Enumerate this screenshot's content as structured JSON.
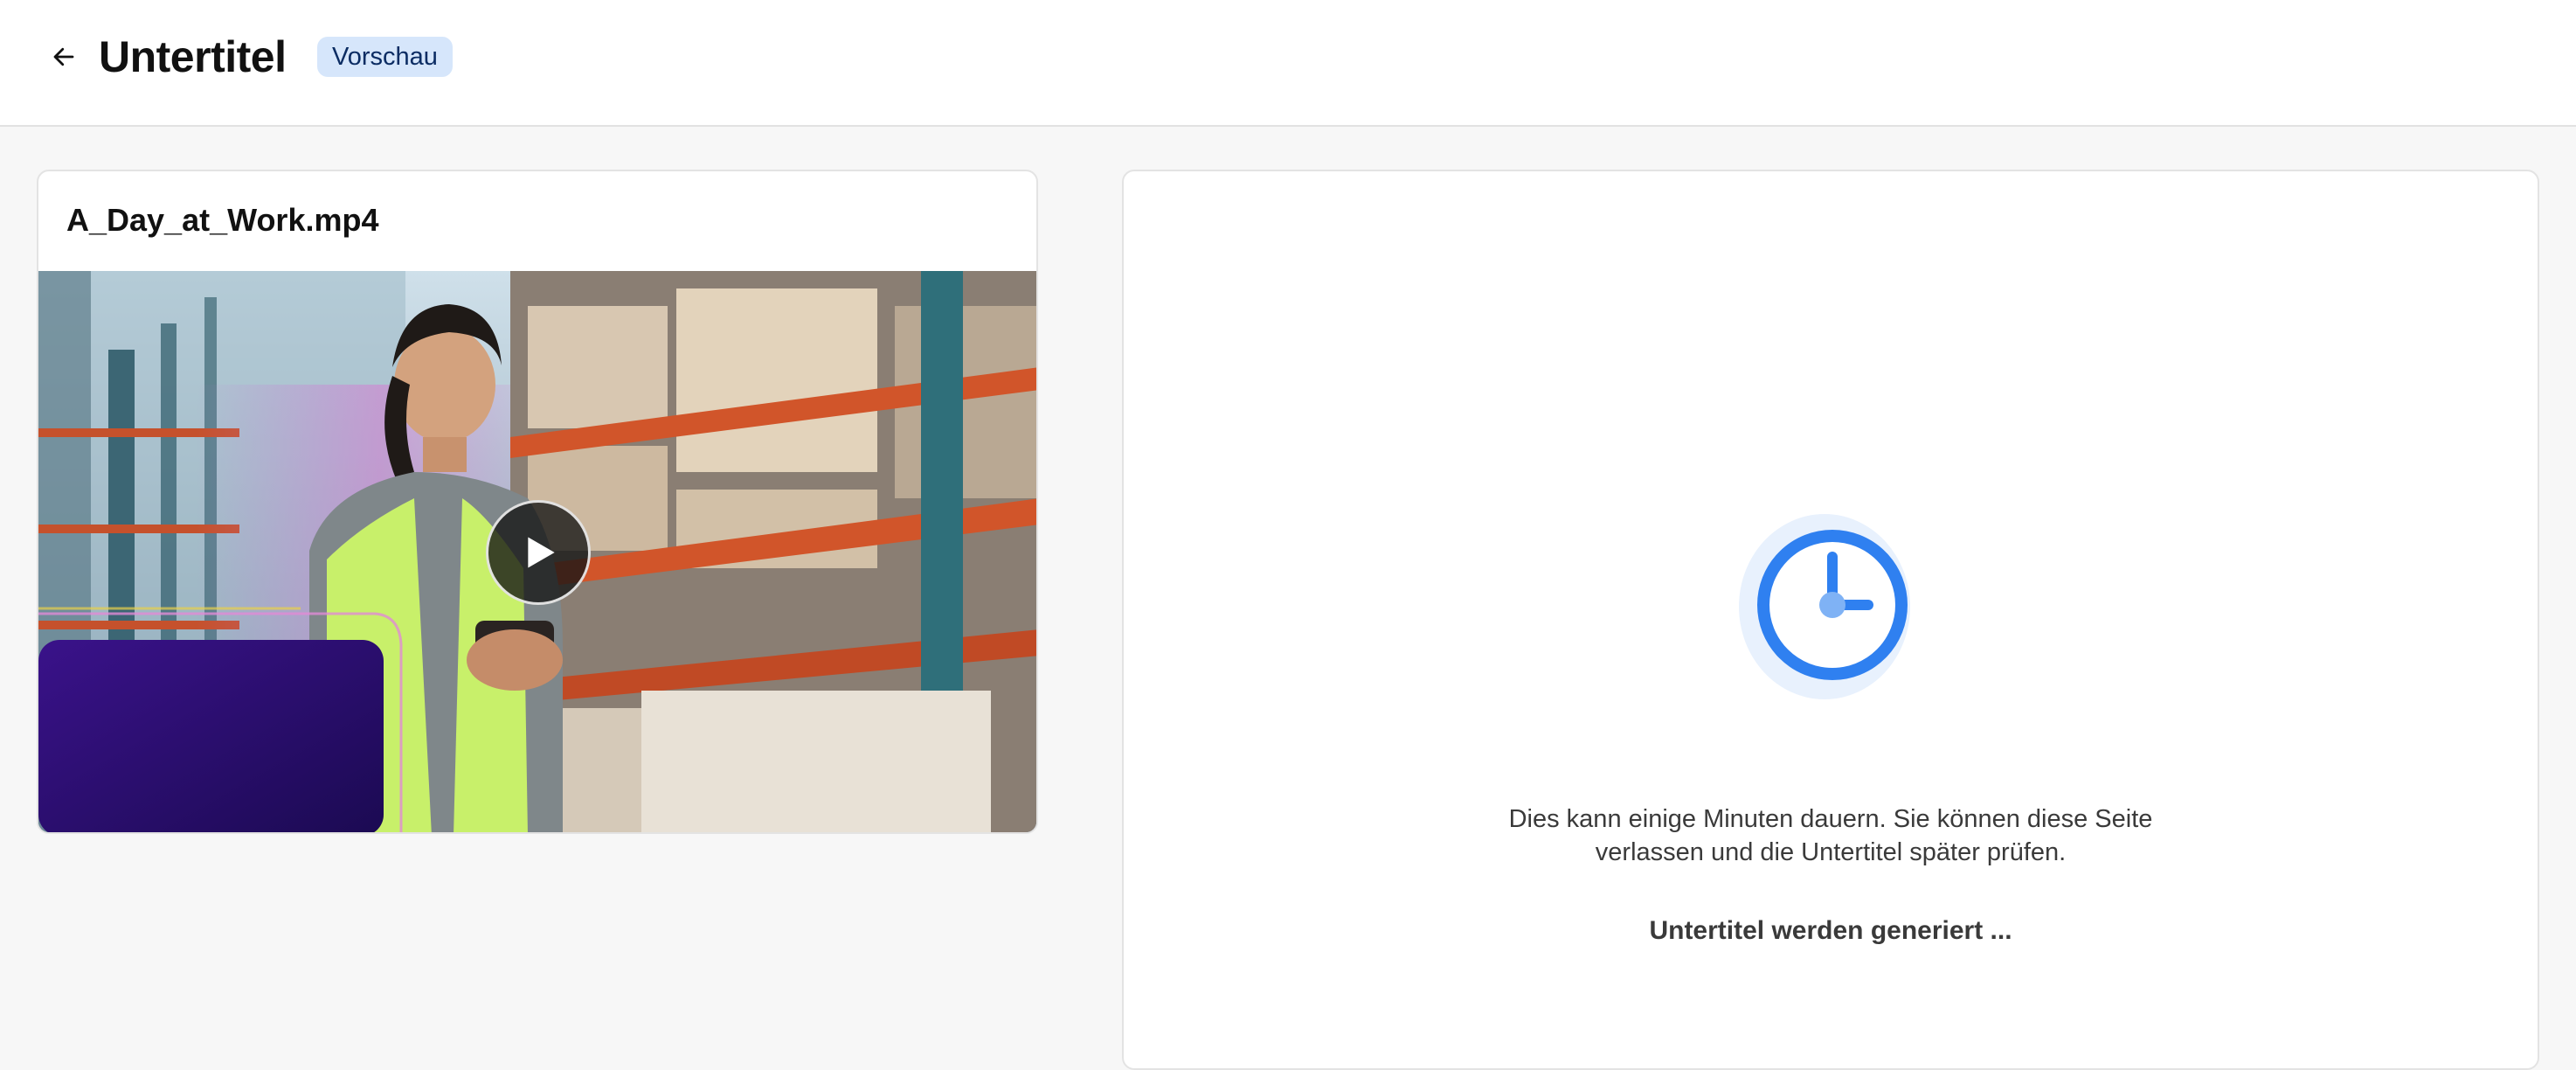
{
  "header": {
    "title": "Untertitel",
    "badge": "Vorschau",
    "back_icon": "arrow-left-icon"
  },
  "video": {
    "filename": "A_Day_at_Work.mp4",
    "play_icon": "play-icon"
  },
  "status": {
    "icon": "clock-icon",
    "title": "Untertitel werden generiert ...",
    "description": "Dies kann einige Minuten dauern. Sie können diese Seite verlassen und die Untertitel später prüfen."
  },
  "colors": {
    "accent": "#2f80f0",
    "badge_bg": "#d6e6fb",
    "badge_text": "#0b2c63"
  }
}
